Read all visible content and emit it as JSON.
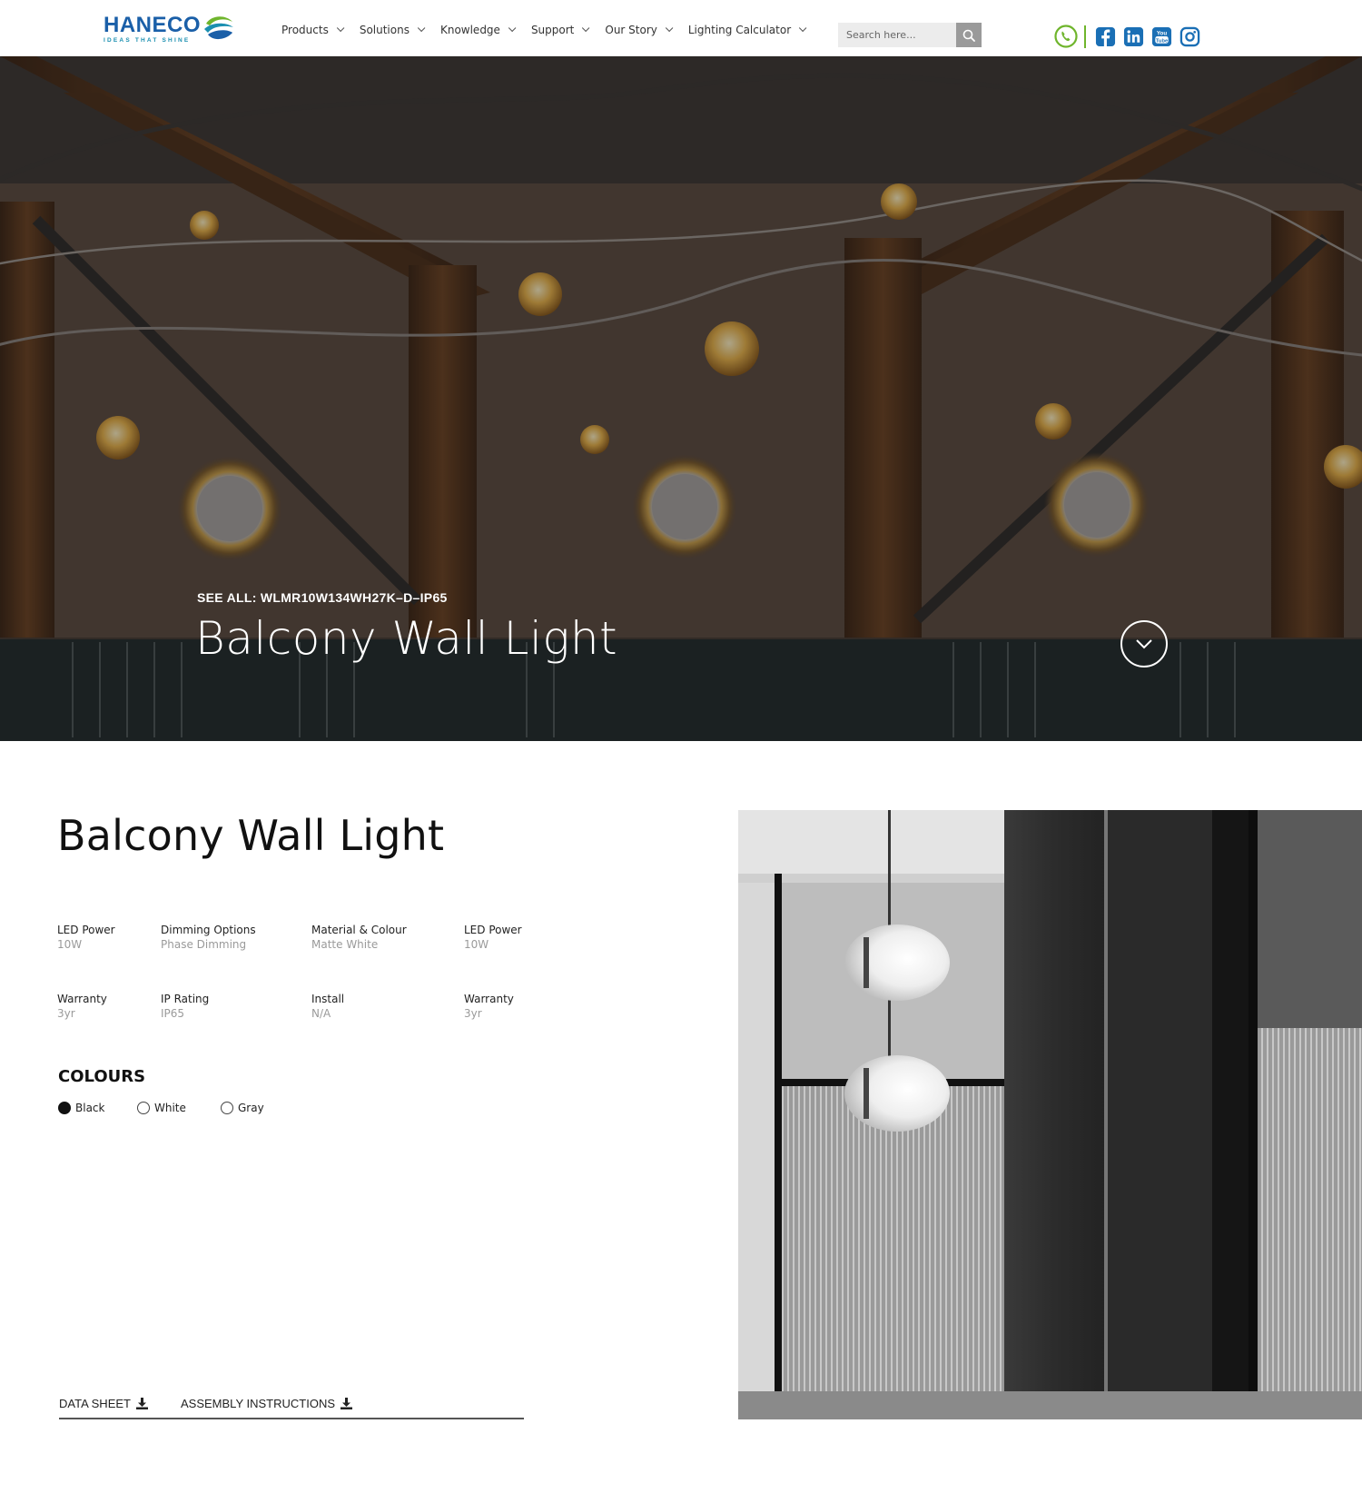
{
  "header": {
    "logo": {
      "name": "HANECO",
      "tagline": "IDEAS THAT SHINE"
    },
    "nav": [
      {
        "label": "Products"
      },
      {
        "label": "Solutions"
      },
      {
        "label": "Knowledge"
      },
      {
        "label": "Support"
      },
      {
        "label": "Our Story"
      },
      {
        "label": "Lighting Calculator"
      }
    ],
    "search": {
      "placeholder": "Search here..."
    },
    "icons": [
      "phone-icon",
      "facebook-icon",
      "linkedin-icon",
      "youtube-icon",
      "instagram-icon",
      "search-icon"
    ],
    "colors": {
      "brand_blue": "#1a5fa8",
      "accent_green": "#6fb52c",
      "social_blue": "#1a6fb5"
    }
  },
  "hero": {
    "see_all": "SEE ALL: WLMR10W134WH27K–D–IP65",
    "title": "Balcony Wall Light",
    "scroll_icon": "chevron-down-icon"
  },
  "product": {
    "title": "Balcony Wall Light",
    "specs": [
      {
        "label": "LED Power",
        "value": "10W"
      },
      {
        "label": "Dimming Options",
        "value": "Phase Dimming"
      },
      {
        "label": "Material & Colour",
        "value": "Matte White"
      },
      {
        "label": "LED Power",
        "value": "10W"
      },
      {
        "label": "Warranty",
        "value": "3yr"
      },
      {
        "label": "IP Rating",
        "value": "IP65"
      },
      {
        "label": "Install",
        "value": "N/A"
      },
      {
        "label": "Warranty",
        "value": "3yr"
      }
    ],
    "colours_heading": "COLOURS",
    "colours": [
      {
        "label": "Black",
        "selected": true
      },
      {
        "label": "White",
        "selected": false
      },
      {
        "label": "Gray",
        "selected": false
      }
    ],
    "downloads": [
      {
        "label": "DATA SHEET",
        "icon": "download-icon"
      },
      {
        "label": "ASSEMBLY INSTRUCTIONS",
        "icon": "download-icon"
      }
    ]
  }
}
